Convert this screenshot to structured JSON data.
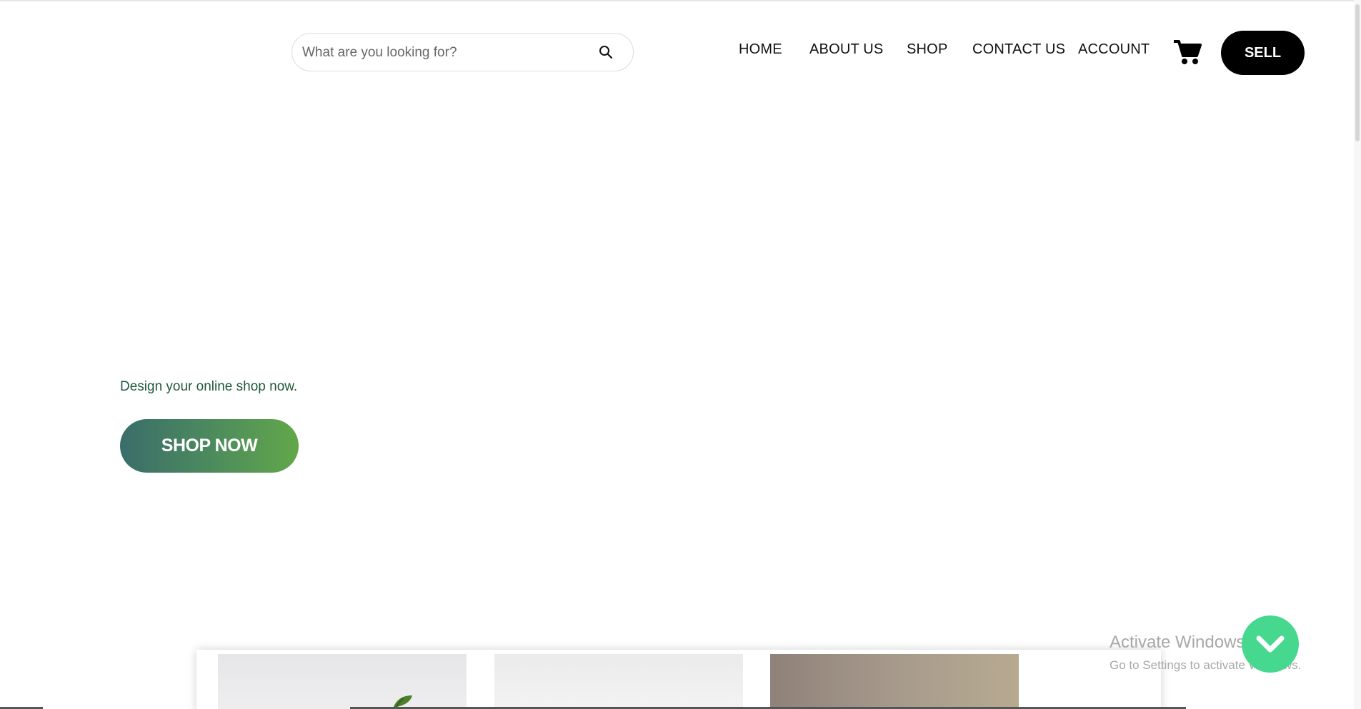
{
  "header": {
    "search": {
      "placeholder": "What are you looking for?",
      "value": "",
      "icon": "search-icon"
    },
    "nav": [
      {
        "label": "HOME"
      },
      {
        "label": "ABOUT US"
      },
      {
        "label": "SHOP"
      },
      {
        "label": "CONTACT US"
      },
      {
        "label": "ACCOUNT"
      }
    ],
    "cart_icon": "cart-icon",
    "sell_label": "SELL"
  },
  "hero": {
    "tagline": "Design your online shop now.",
    "cta_label": "SHOP NOW"
  },
  "product_cards": [
    {
      "image": "plant-photo"
    },
    {
      "image": "light-grey-photo"
    },
    {
      "image": "brown-interior-photo"
    }
  ],
  "watermark": {
    "title": "Activate Windows",
    "subtitle": "Go to Settings to activate Windows."
  },
  "scroll_down_icon": "chevron-down-icon",
  "colors": {
    "accent_green": "#47d88f",
    "cta_gradient_start": "#3a6d6a",
    "cta_gradient_end": "#62a74a",
    "tagline_color": "#1f5a3a",
    "sell_bg": "#000000"
  }
}
